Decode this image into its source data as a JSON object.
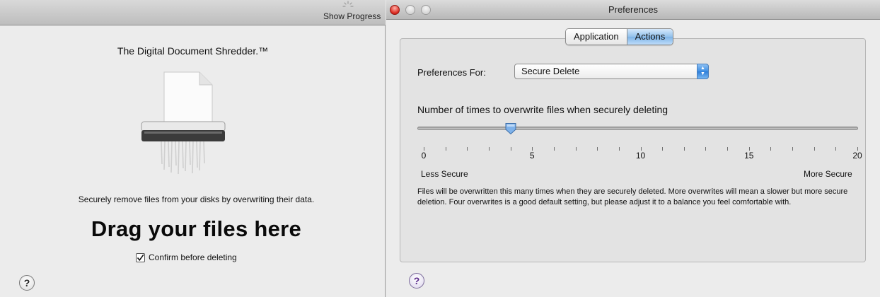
{
  "left_window": {
    "toolbar": {
      "show_progress_label": "Show Progress",
      "spinner_icon": "spinner-icon"
    },
    "app_title": "The Digital Document Shredder.™",
    "shredder_icon": "shredder-icon",
    "description": "Securely remove files from your disks by overwriting their data.",
    "drop_prompt": "Drag your files here",
    "confirm_checkbox": {
      "label": "Confirm before deleting",
      "checked": true
    },
    "help_button": "?"
  },
  "preferences_window": {
    "title": "Preferences",
    "window_controls": [
      "close",
      "minimize",
      "zoom"
    ],
    "tabs": [
      {
        "label": "Application",
        "active": false
      },
      {
        "label": "Actions",
        "active": true
      }
    ],
    "preferences_for": {
      "label": "Preferences For:",
      "selected": "Secure Delete"
    },
    "overwrite": {
      "heading": "Number of times to overwrite files when securely deleting",
      "slider": {
        "min": 0,
        "max": 20,
        "value": 4,
        "tick_count": 21
      },
      "tick_labels": [
        "0",
        "5",
        "10",
        "15",
        "20"
      ],
      "low_label": "Less Secure",
      "high_label": "More Secure",
      "explanation": "Files will be overwritten this many times when they are securely deleted.  More overwrites will mean a slower but more secure deletion.  Four overwrites is a good default setting, but please adjust it to a balance you feel comfortable with."
    },
    "help_button": "?"
  },
  "colors": {
    "close_button": "#dd2f25",
    "active_tab": "#93c1ec",
    "popup_arrows": "#3f8fe3",
    "slider_knob": "#7fb2ea"
  }
}
